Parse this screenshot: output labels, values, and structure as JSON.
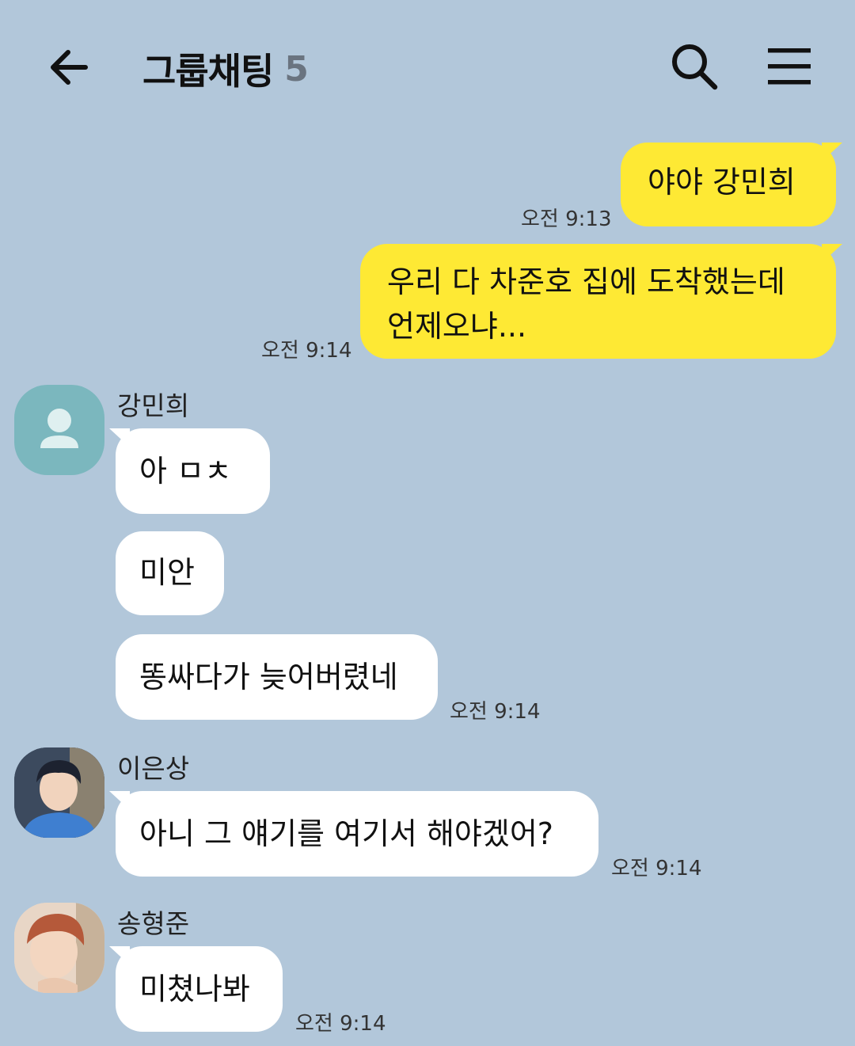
{
  "header": {
    "title": "그룹채팅",
    "member_count": "5"
  },
  "messages": {
    "m1": {
      "text": "야야 강민희",
      "time": "오전 9:13"
    },
    "m2": {
      "line1": "우리 다 차준호 집에 도착했는데",
      "line2": "언제오냐...",
      "time": "오전 9:14"
    },
    "g1": {
      "sender": "강민희",
      "texts": [
        "아 ㅁㅊ",
        "미안",
        "똥싸다가 늦어버렸네"
      ],
      "time": "오전 9:14"
    },
    "g2": {
      "sender": "이은상",
      "text": "아니 그 얘기를 여기서 해야겠어?",
      "time": "오전 9:14"
    },
    "g3": {
      "sender": "송형준",
      "text": "미쳤나봐",
      "time": "오전 9:14"
    }
  },
  "colors": {
    "background": "#b2c7da",
    "my_bubble": "#fee934",
    "their_bubble": "#ffffff",
    "default_avatar": "#7bb7be"
  }
}
